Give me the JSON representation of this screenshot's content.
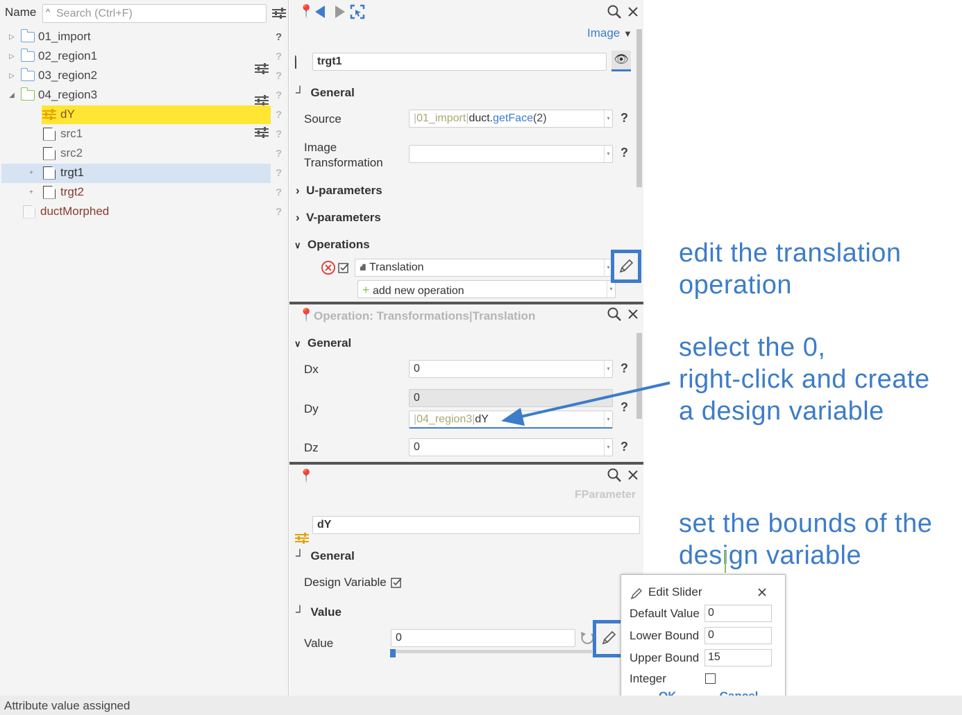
{
  "left_panel": {
    "header_label": "Name",
    "search_placeholder": "Search (Ctrl+F)",
    "help_mark": "?",
    "tree": [
      {
        "label": "01_import",
        "kind": "folder"
      },
      {
        "label": "02_region1",
        "kind": "folder"
      },
      {
        "label": "03_region2",
        "kind": "folder"
      },
      {
        "label": "04_region3",
        "kind": "folder-open"
      },
      {
        "label": "dY",
        "kind": "parameter",
        "highlight": "#ffe633"
      },
      {
        "label": "src1",
        "kind": "doc"
      },
      {
        "label": "src2",
        "kind": "doc"
      },
      {
        "label": "trgt1",
        "kind": "doc",
        "selected": true
      },
      {
        "label": "trgt2",
        "kind": "doc"
      },
      {
        "label": "ductMorphed",
        "kind": "doc"
      }
    ]
  },
  "top_panel": {
    "view_label": "Image",
    "name_value": "trgt1",
    "section_general": "General",
    "source_label": "Source",
    "source_path": "01_import",
    "source_object": "duct.",
    "source_method": "getFace",
    "source_arg": "(2)",
    "image_transform_label_line1": "Image",
    "image_transform_label_line2": "Transformation",
    "section_u": "U-parameters",
    "section_v": "V-parameters",
    "section_operations": "Operations",
    "operation_value": "Translation",
    "add_operation": "add new operation"
  },
  "op_panel": {
    "title": "Operation: Transformations",
    "title_suffix": "Translation",
    "section_general": "General",
    "dx_label": "Dx",
    "dx_value": "0",
    "dy_label": "Dy",
    "dy_value": "0",
    "dy_path": "04_region3",
    "dy_ref": "dY",
    "dz_label": "Dz",
    "dz_value": "0"
  },
  "param_panel": {
    "type_label": "FParameter",
    "name_value": "dY",
    "section_general": "General",
    "design_variable_label": "Design Variable",
    "section_value": "Value",
    "value_label": "Value",
    "value_value": "0"
  },
  "dialog": {
    "title": "Edit Slider",
    "default_label": "Default Value",
    "default_value": "0",
    "lower_label": "Lower Bound",
    "lower_value": "0",
    "upper_label": "Upper Bound",
    "upper_value": "15",
    "integer_label": "Integer",
    "ok_label": "OK",
    "cancel_label": "Cancel"
  },
  "annotations": {
    "a1_line1": "edit the translation",
    "a1_line2": "operation",
    "a2_line1": "select the 0,",
    "a2_line2": "right-click and create",
    "a2_line3": "a design variable",
    "a3_line1": "set the bounds of the",
    "a3_line2": "design variable",
    "color": "#3d7cc9"
  },
  "status": {
    "text": "Attribute value assigned"
  }
}
